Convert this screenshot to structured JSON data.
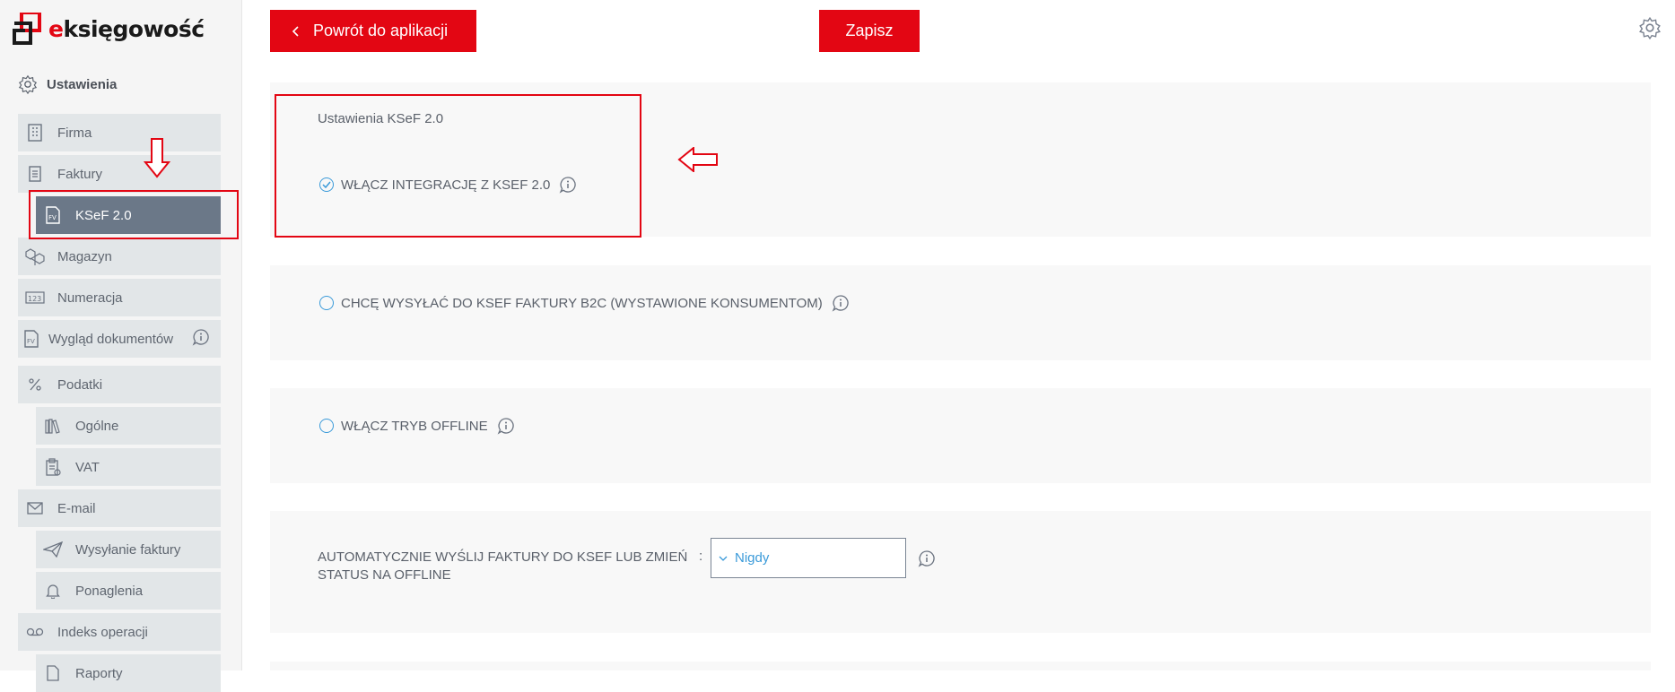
{
  "app": {
    "logo_prefix": "e",
    "logo_rest": "księgowość"
  },
  "sidebar": {
    "section_title": "Ustawienia",
    "items": [
      {
        "label": "Firma",
        "icon": "building-icon"
      },
      {
        "label": "Faktury",
        "icon": "document-icon"
      },
      {
        "label": "KSeF 2.0",
        "icon": "fv-document-icon",
        "active": true
      },
      {
        "label": "Magazyn",
        "icon": "boxes-icon"
      },
      {
        "label": "Numeracja",
        "icon": "numbering-icon"
      },
      {
        "label": "Wygląd dokumentów",
        "icon": "fv-document-icon"
      },
      {
        "label": "Podatki",
        "icon": "percent-icon"
      },
      {
        "label": "Ogólne",
        "icon": "books-icon"
      },
      {
        "label": "VAT",
        "icon": "clipboard-icon"
      },
      {
        "label": "E-mail",
        "icon": "envelope-icon"
      },
      {
        "label": "Wysyłanie faktury",
        "icon": "paper-plane-icon"
      },
      {
        "label": "Ponaglenia",
        "icon": "bell-icon"
      },
      {
        "label": "Indeks operacji",
        "icon": "tape-icon"
      },
      {
        "label": "Raporty",
        "icon": "report-icon"
      }
    ]
  },
  "toolbar": {
    "back_label": "Powrót do aplikacji",
    "save_label": "Zapisz"
  },
  "main": {
    "card_title": "Ustawienia KSeF 2.0",
    "options": [
      {
        "label": "WŁĄCZ INTEGRACJĘ Z KSEF 2.0",
        "checked": true
      },
      {
        "label": "CHCĘ WYSYŁAĆ DO KSEF FAKTURY B2C (WYSTAWIONE KONSUMENTOM)",
        "checked": false
      },
      {
        "label": "WŁĄCZ TRYB OFFLINE",
        "checked": false
      }
    ],
    "auto_send": {
      "label": "AUTOMATYCZNIE WYŚLIJ FAKTURY DO KSEF LUB ZMIEŃ STATUS NA OFFLINE",
      "colon": ":",
      "selected": "Nigdy"
    }
  },
  "colors": {
    "brand_red": "#e30613",
    "active_nav": "#6b7888",
    "accent_blue": "#3a9ad9"
  }
}
